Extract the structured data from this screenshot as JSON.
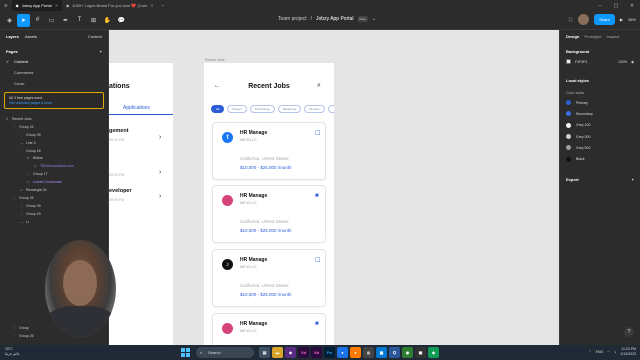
{
  "browser": {
    "tabs": [
      {
        "label": "Jobzy App Portal",
        "active": true
      },
      {
        "label": "1000+ Logos Brand For you love ❤️ (Com",
        "active": false
      }
    ]
  },
  "toolbar": {
    "team": "Team project",
    "separator": "/",
    "file": "Jobzy App Portal",
    "badge": "Free",
    "share_label": "Share",
    "zoom": "36%"
  },
  "left_panel": {
    "tabs": [
      "Layers",
      "Assets"
    ],
    "page_selector": "Content",
    "pages_heading": "Pages",
    "pages": [
      {
        "label": "Content",
        "current": true
      },
      {
        "label": "Comments",
        "current": false
      },
      {
        "label": "Cover",
        "current": false
      }
    ],
    "warning_text": "All 3 free pages used",
    "warning_link": "Get unlimited pages & more",
    "layers": [
      {
        "label": "Recent Jobs",
        "indent": 0,
        "icon": "#",
        "kind": "frame"
      },
      {
        "label": "Group 24",
        "indent": 1,
        "icon": "⋮",
        "kind": "group"
      },
      {
        "label": "Group 39",
        "indent": 2,
        "icon": "⋮",
        "kind": "group"
      },
      {
        "label": "Line 3",
        "indent": 2,
        "icon": "—",
        "kind": "line"
      },
      {
        "label": "Group 18",
        "indent": 2,
        "icon": "⋮",
        "kind": "group"
      },
      {
        "label": "Button",
        "indent": 3,
        "icon": "#",
        "kind": "frame"
      },
      {
        "label": "TikTok/socialicon.com",
        "indent": 4,
        "icon": "◇",
        "kind": "link"
      },
      {
        "label": "Group 17",
        "indent": 3,
        "icon": "⋮",
        "kind": "group"
      },
      {
        "label": "curved / bookmark",
        "indent": 3,
        "icon": "◇",
        "kind": "comp"
      },
      {
        "label": "Rectangle 24",
        "indent": 2,
        "icon": "▭",
        "kind": "rect"
      },
      {
        "label": "Group 26",
        "indent": 1,
        "icon": "⋮",
        "kind": "group"
      },
      {
        "label": "Group 39",
        "indent": 2,
        "icon": "⋮",
        "kind": "group"
      },
      {
        "label": "Group 29",
        "indent": 2,
        "icon": "⋮",
        "kind": "group"
      },
      {
        "label": "Li",
        "indent": 2,
        "icon": "—",
        "kind": "line"
      }
    ],
    "layers_bottom": [
      {
        "label": "Group",
        "indent": 1,
        "icon": "⋮",
        "kind": "group"
      },
      {
        "label": "Group 26",
        "indent": 1,
        "icon": "⋮",
        "kind": "group"
      }
    ]
  },
  "canvas": {
    "frame_label": "Recent Jobs",
    "left_frame": {
      "title": "ations",
      "tab": "Applications",
      "jobs": [
        {
          "title": "gement",
          "date": "05:00 PM"
        },
        {
          "title": "",
          "date": "05:00 PM"
        },
        {
          "title": "eveloper",
          "date": "05:00 PM"
        }
      ]
    },
    "main_frame": {
      "title": "Recent Jobs",
      "chips": [
        {
          "label": "All",
          "on": true
        },
        {
          "label": "Design",
          "on": false
        },
        {
          "label": "Technology",
          "on": false
        },
        {
          "label": "Marketing",
          "on": false
        },
        {
          "label": "Finance",
          "on": false
        },
        {
          "label": "",
          "on": false
        }
      ],
      "cards": [
        {
          "role": "HR Manage",
          "company": "META LLC",
          "location": "California, United States",
          "salary": "$10,000 - $25,000 /month",
          "logo": "f",
          "logo_color": "#1877f2",
          "bookmark": "☐"
        },
        {
          "role": "HR Manage",
          "company": "META LLC",
          "location": "California, United States",
          "salary": "$10,000 - $25,000 /month",
          "logo": "",
          "logo_color": "#d6457a",
          "bookmark": "■"
        },
        {
          "role": "HR Manage",
          "company": "META LLC",
          "location": "California, United States",
          "salary": "$10,000 - $25,000 /month",
          "logo": "♪",
          "logo_color": "#111111",
          "bookmark": "☐"
        },
        {
          "role": "HR Manage",
          "company": "META LLC",
          "location": "",
          "salary": "",
          "logo": "",
          "logo_color": "#d6457a",
          "bookmark": "■"
        }
      ]
    }
  },
  "right_panel": {
    "tabs": [
      "Design",
      "Prototype",
      "Inspect"
    ],
    "background_heading": "Background",
    "bg_hex": "F4F4F4",
    "bg_opacity": "100%",
    "local_styles_heading": "Local styles",
    "color_styles_heading": "Color styles",
    "styles": [
      {
        "name": "Primary",
        "color": "#2c5ed6"
      },
      {
        "name": "Secondary",
        "color": "#3b6cf0"
      },
      {
        "name": "Grey 100",
        "color": "#f5f5f5"
      },
      {
        "name": "Grey 300",
        "color": "#d0d0d0"
      },
      {
        "name": "Grey 500",
        "color": "#9e9e9e"
      },
      {
        "name": "Black",
        "color": "#111111"
      }
    ],
    "export_heading": "Export"
  },
  "taskbar": {
    "weather_temp": "15°C",
    "weather_desc": "غائم جزئيا",
    "search_label": "Search",
    "lang": "ENG",
    "time": "11:23 PM",
    "date": "1/12/2023"
  }
}
